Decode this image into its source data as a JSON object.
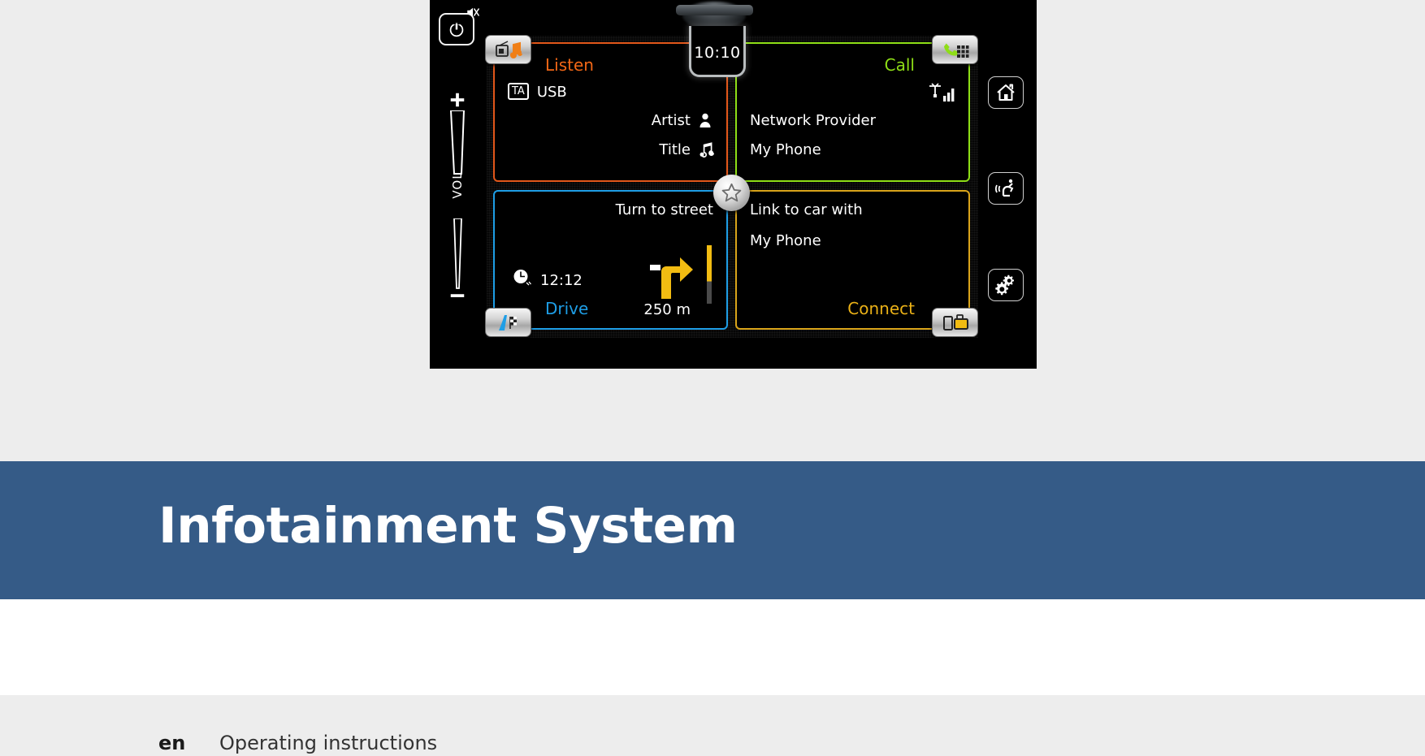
{
  "document": {
    "title": "Infotainment System",
    "language_code": "en",
    "doc_type": "Operating instructions"
  },
  "colors": {
    "band_blue": "#355b87",
    "page_grey": "#ededed",
    "listen_orange": "#f26716",
    "call_green": "#8ede16",
    "drive_blue": "#1e9ee6",
    "connect_yellow": "#eab117"
  },
  "device": {
    "clock": "10:10",
    "hardware": {
      "power_button": "power-icon",
      "mute_indicator": "mute-icon",
      "volume_label": "VOL",
      "volume_plus": "plus-icon",
      "volume_minus": "minus-icon",
      "knob": "rotary-knob",
      "right_buttons": [
        {
          "name": "home",
          "icon": "home-icon"
        },
        {
          "name": "voice-control",
          "icon": "voice-control-icon"
        },
        {
          "name": "settings",
          "icon": "gears-icon"
        }
      ]
    },
    "center_button": {
      "icon": "star-icon",
      "label": "Favorites"
    },
    "tiles": {
      "listen": {
        "title": "Listen",
        "button_icon": "radio-music-icon",
        "badge": "TA",
        "source": "USB",
        "rows": [
          {
            "label": "Artist",
            "icon": "person-icon"
          },
          {
            "label": "Title",
            "icon": "music-note-icon"
          }
        ]
      },
      "call": {
        "title": "Call",
        "button_icon": "phone-keypad-icon",
        "signal_icon": "antenna-signal-icon",
        "rows": [
          {
            "label": "Network Provider"
          },
          {
            "label": "My Phone"
          }
        ]
      },
      "drive": {
        "title": "Drive",
        "button_icon": "road-flag-icon",
        "heading": "Turn to street",
        "eta_icon": "clock-icon",
        "eta": "12:12",
        "distance": "250 m",
        "maneuver_icon": "turn-right-icon"
      },
      "connect": {
        "title": "Connect",
        "button_icon": "phone-media-device-icon",
        "rows": [
          {
            "label": "Link to car with"
          },
          {
            "label": "My Phone"
          }
        ]
      }
    }
  }
}
